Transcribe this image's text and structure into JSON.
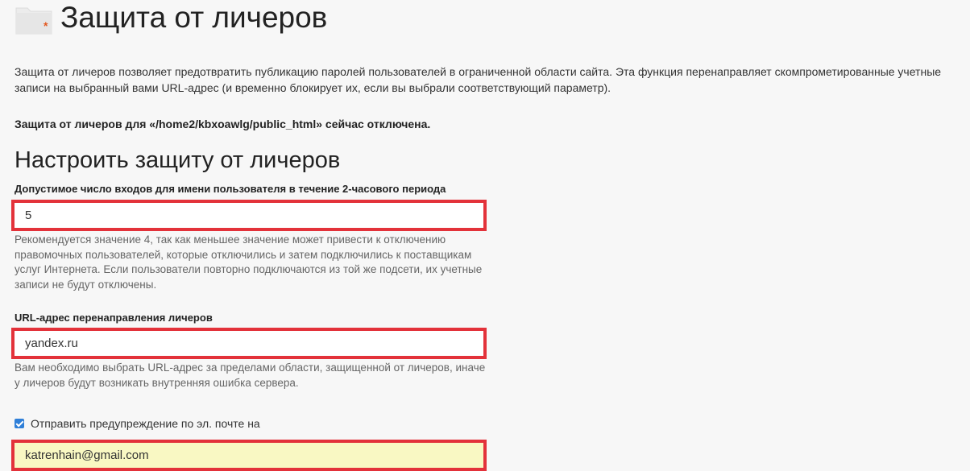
{
  "header": {
    "title": "Защита от личеров",
    "icon": "folder-lock-icon"
  },
  "intro": "Защита от личеров позволяет предотвратить публикацию паролей пользователей в ограниченной области сайта. Эта функция перенаправляет скомпрометированные учетные записи на выбранный вами URL-адрес (и временно блокирует их, если вы выбрали соответствующий параметр).",
  "status": "Защита от личеров для «/home2/kbxoawlg/public_html» сейчас отключена.",
  "section_title": "Настроить защиту от личеров",
  "fields": {
    "logins": {
      "label": "Допустимое число входов для имени пользователя в течение 2-часового периода",
      "value": "5",
      "help": "Рекомендуется значение 4, так как меньшее значение может привести к отключению правомочных пользователей, которые отключились и затем подключились к поставщикам услуг Интернета. Если пользователи повторно подключаются из той же подсети, их учетные записи не будут отключены."
    },
    "redirect": {
      "label": "URL-адрес перенаправления личеров",
      "value": "yandex.ru",
      "help": "Вам необходимо выбрать URL-адрес за пределами области, защищенной от личеров, иначе у личеров будут возникать внутренняя ошибка сервера."
    },
    "email": {
      "checkbox_label": "Отправить предупреждение по эл. почте на",
      "checked": true,
      "value": "katrenhain@gmail.com"
    }
  },
  "colors": {
    "highlight_border": "#e3323a",
    "checkbox_accent": "#2f7fd8",
    "email_field_bg": "#f9f8c3"
  }
}
